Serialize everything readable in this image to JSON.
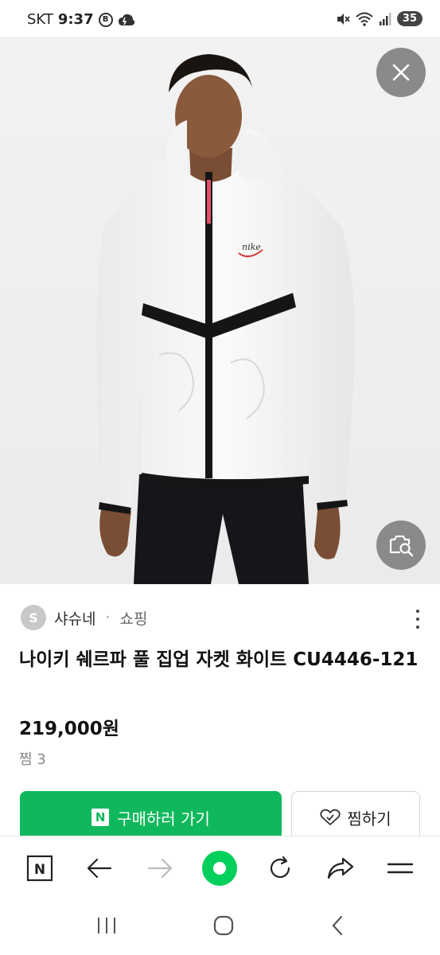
{
  "status_bar": {
    "carrier": "SKT",
    "time": "9:37",
    "notification_badge": "B",
    "battery_level": "35"
  },
  "product_image": {
    "brand_logo": "nike",
    "alt": "White sherpa full-zip hooded jacket"
  },
  "seller": {
    "avatar_letter": "S",
    "name": "샤슈네",
    "separator": "·",
    "category": "쇼핑"
  },
  "product": {
    "title": "나이키 쉐르파 풀 집업 자켓 화이트 CU4446-121",
    "price": "219,000원",
    "likes": "찜 3"
  },
  "actions": {
    "buy_badge": "N",
    "buy_label": "구매하러 가기",
    "wish_label": "찜하기"
  },
  "browser_bar": {
    "n_label": "N"
  },
  "colors": {
    "brand_green": "#0fb85c",
    "naver_green": "#03cf5d",
    "overlay_gray": "#8a8a8a"
  }
}
